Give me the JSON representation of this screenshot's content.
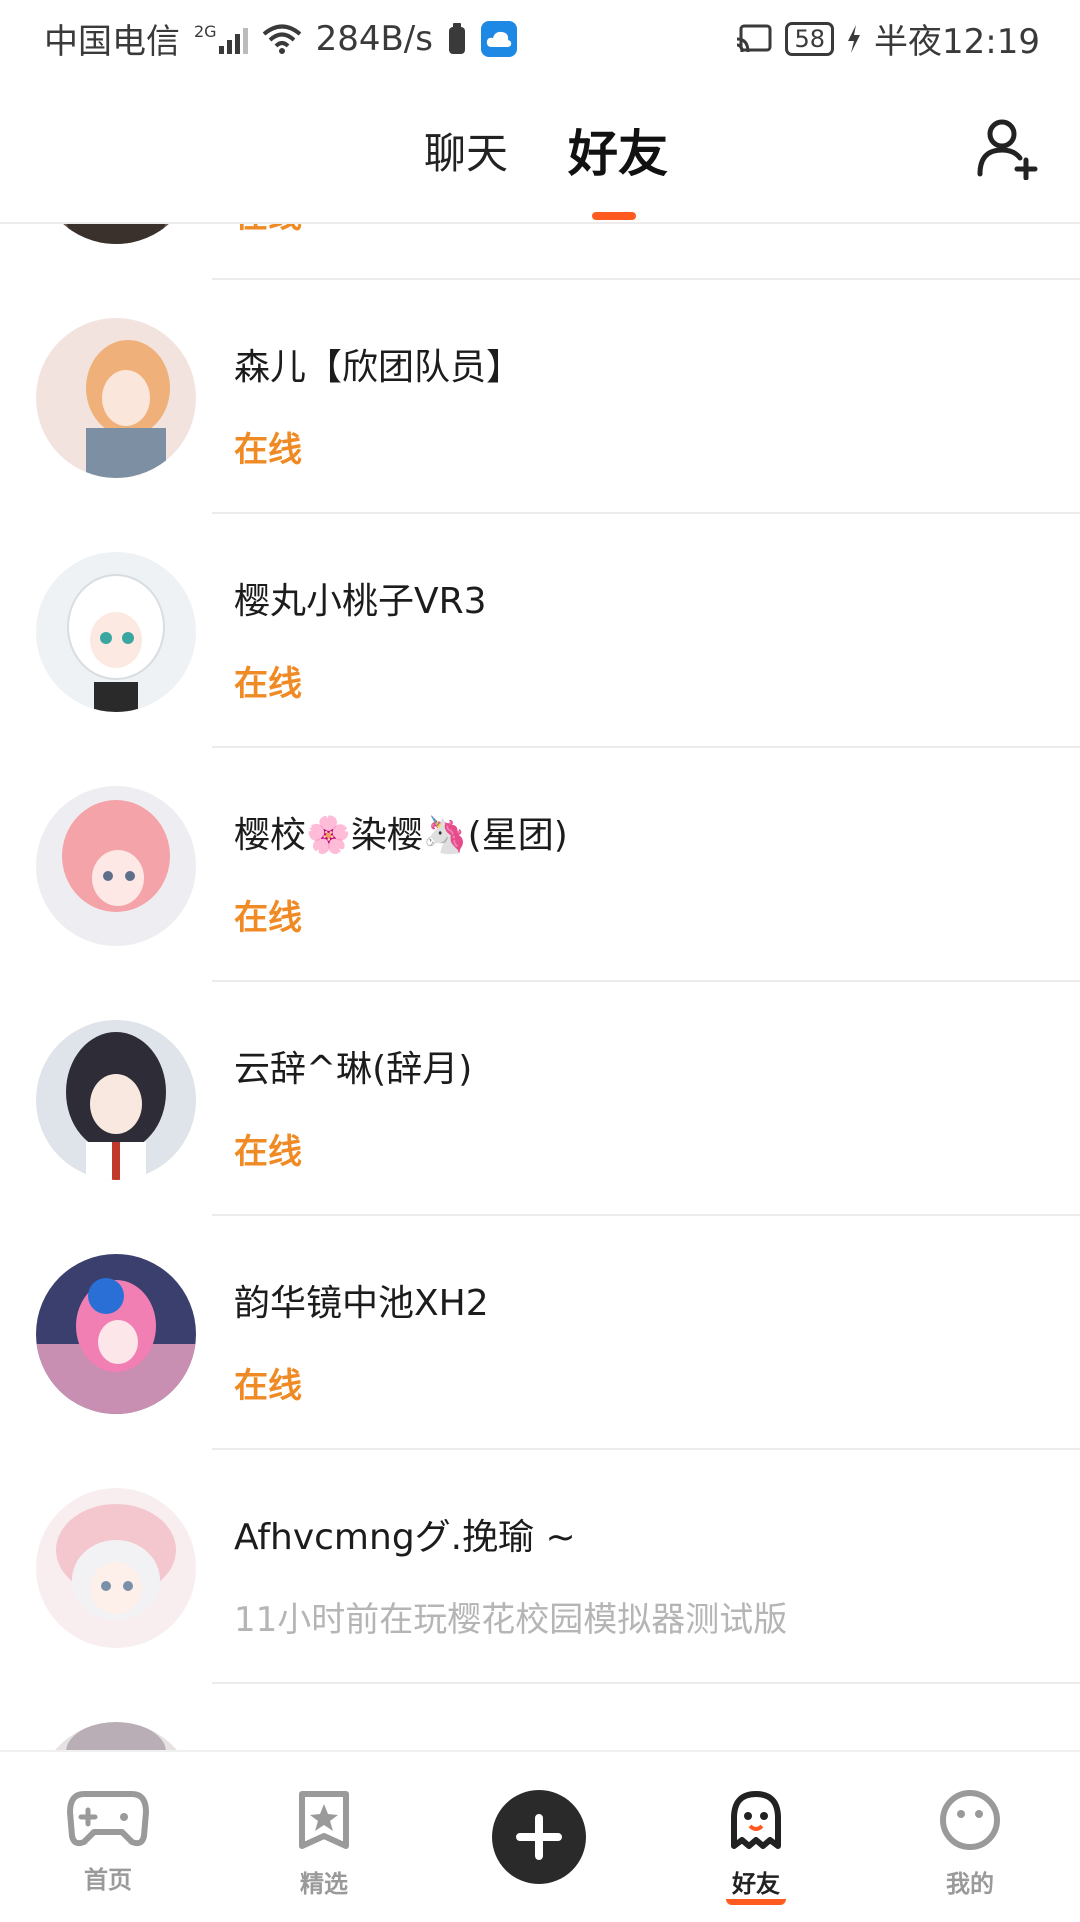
{
  "status_bar": {
    "carrier": "中国电信",
    "network": "2G",
    "speed": "284B/s",
    "battery": "58",
    "time": "半夜12:19"
  },
  "header": {
    "tabs": [
      {
        "label": "聊天",
        "active": false
      },
      {
        "label": "好友",
        "active": true
      }
    ],
    "accent_color": "#ff5a1f"
  },
  "friends": [
    {
      "name": "",
      "status": "在线",
      "online": true
    },
    {
      "name": "森儿【欣团队员】",
      "status": "在线",
      "online": true
    },
    {
      "name": "樱丸小桃子VR3",
      "status": "在线",
      "online": true
    },
    {
      "name": "樱校🌸染樱🦄(星团)",
      "status": "在线",
      "online": true
    },
    {
      "name": "云辞^琳(辞月)",
      "status": "在线",
      "online": true
    },
    {
      "name": "韵华镜中池XH2",
      "status": "在线",
      "online": true
    },
    {
      "name": "Afhvcmngグ.挽瑜 ~",
      "status": "11小时前在玩樱花校园模拟器测试版",
      "online": false
    }
  ],
  "bottom_nav": {
    "items": [
      {
        "label": "首页",
        "icon": "gamepad-icon",
        "active": false
      },
      {
        "label": "精选",
        "icon": "star-icon",
        "active": false
      },
      {
        "label": "",
        "icon": "plus-icon",
        "active": false
      },
      {
        "label": "好友",
        "icon": "ghost-icon",
        "active": true
      },
      {
        "label": "我的",
        "icon": "face-icon",
        "active": false
      }
    ]
  },
  "colors": {
    "online": "#f08a24",
    "offline": "#b5b5b5"
  }
}
